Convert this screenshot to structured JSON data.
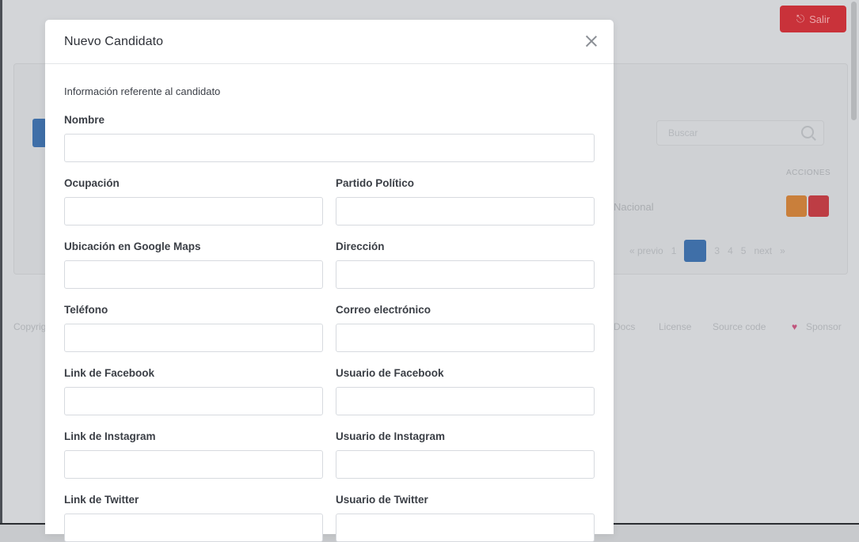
{
  "background": {
    "logout_label": "Salir",
    "search_placeholder": "Buscar",
    "acciones_header": "ACCIONES",
    "row_text": "Nacional",
    "pager": [
      "« previo",
      "1",
      "2",
      "3",
      "4",
      "5",
      "next",
      "»"
    ],
    "footer_links": [
      "Copyright",
      "Docs",
      "License",
      "Source code",
      "Sponsor"
    ]
  },
  "modal": {
    "title": "Nuevo Candidato",
    "intro": "Información referente al candidato",
    "fields": {
      "nombre": "Nombre",
      "ocupacion": "Ocupación",
      "partido": "Partido Político",
      "maps": "Ubicación en Google Maps",
      "direccion": "Dirección",
      "telefono": "Teléfono",
      "correo": "Correo electrónico",
      "fb_link": "Link de Facebook",
      "fb_user": "Usuario de Facebook",
      "ig_link": "Link de Instagram",
      "ig_user": "Usuario de Instagram",
      "tw_link": "Link de Twitter",
      "tw_user": "Usuario de Twitter"
    },
    "values": {
      "nombre": "",
      "ocupacion": "",
      "partido": "",
      "maps": "",
      "direccion": "",
      "telefono": "",
      "correo": "",
      "fb_link": "",
      "fb_user": "",
      "ig_link": "",
      "ig_user": "",
      "tw_link": "",
      "tw_user": ""
    }
  },
  "icons": {
    "close": "close-icon",
    "search": "search-icon",
    "logout": "logout-icon",
    "heart": "heart-icon"
  }
}
